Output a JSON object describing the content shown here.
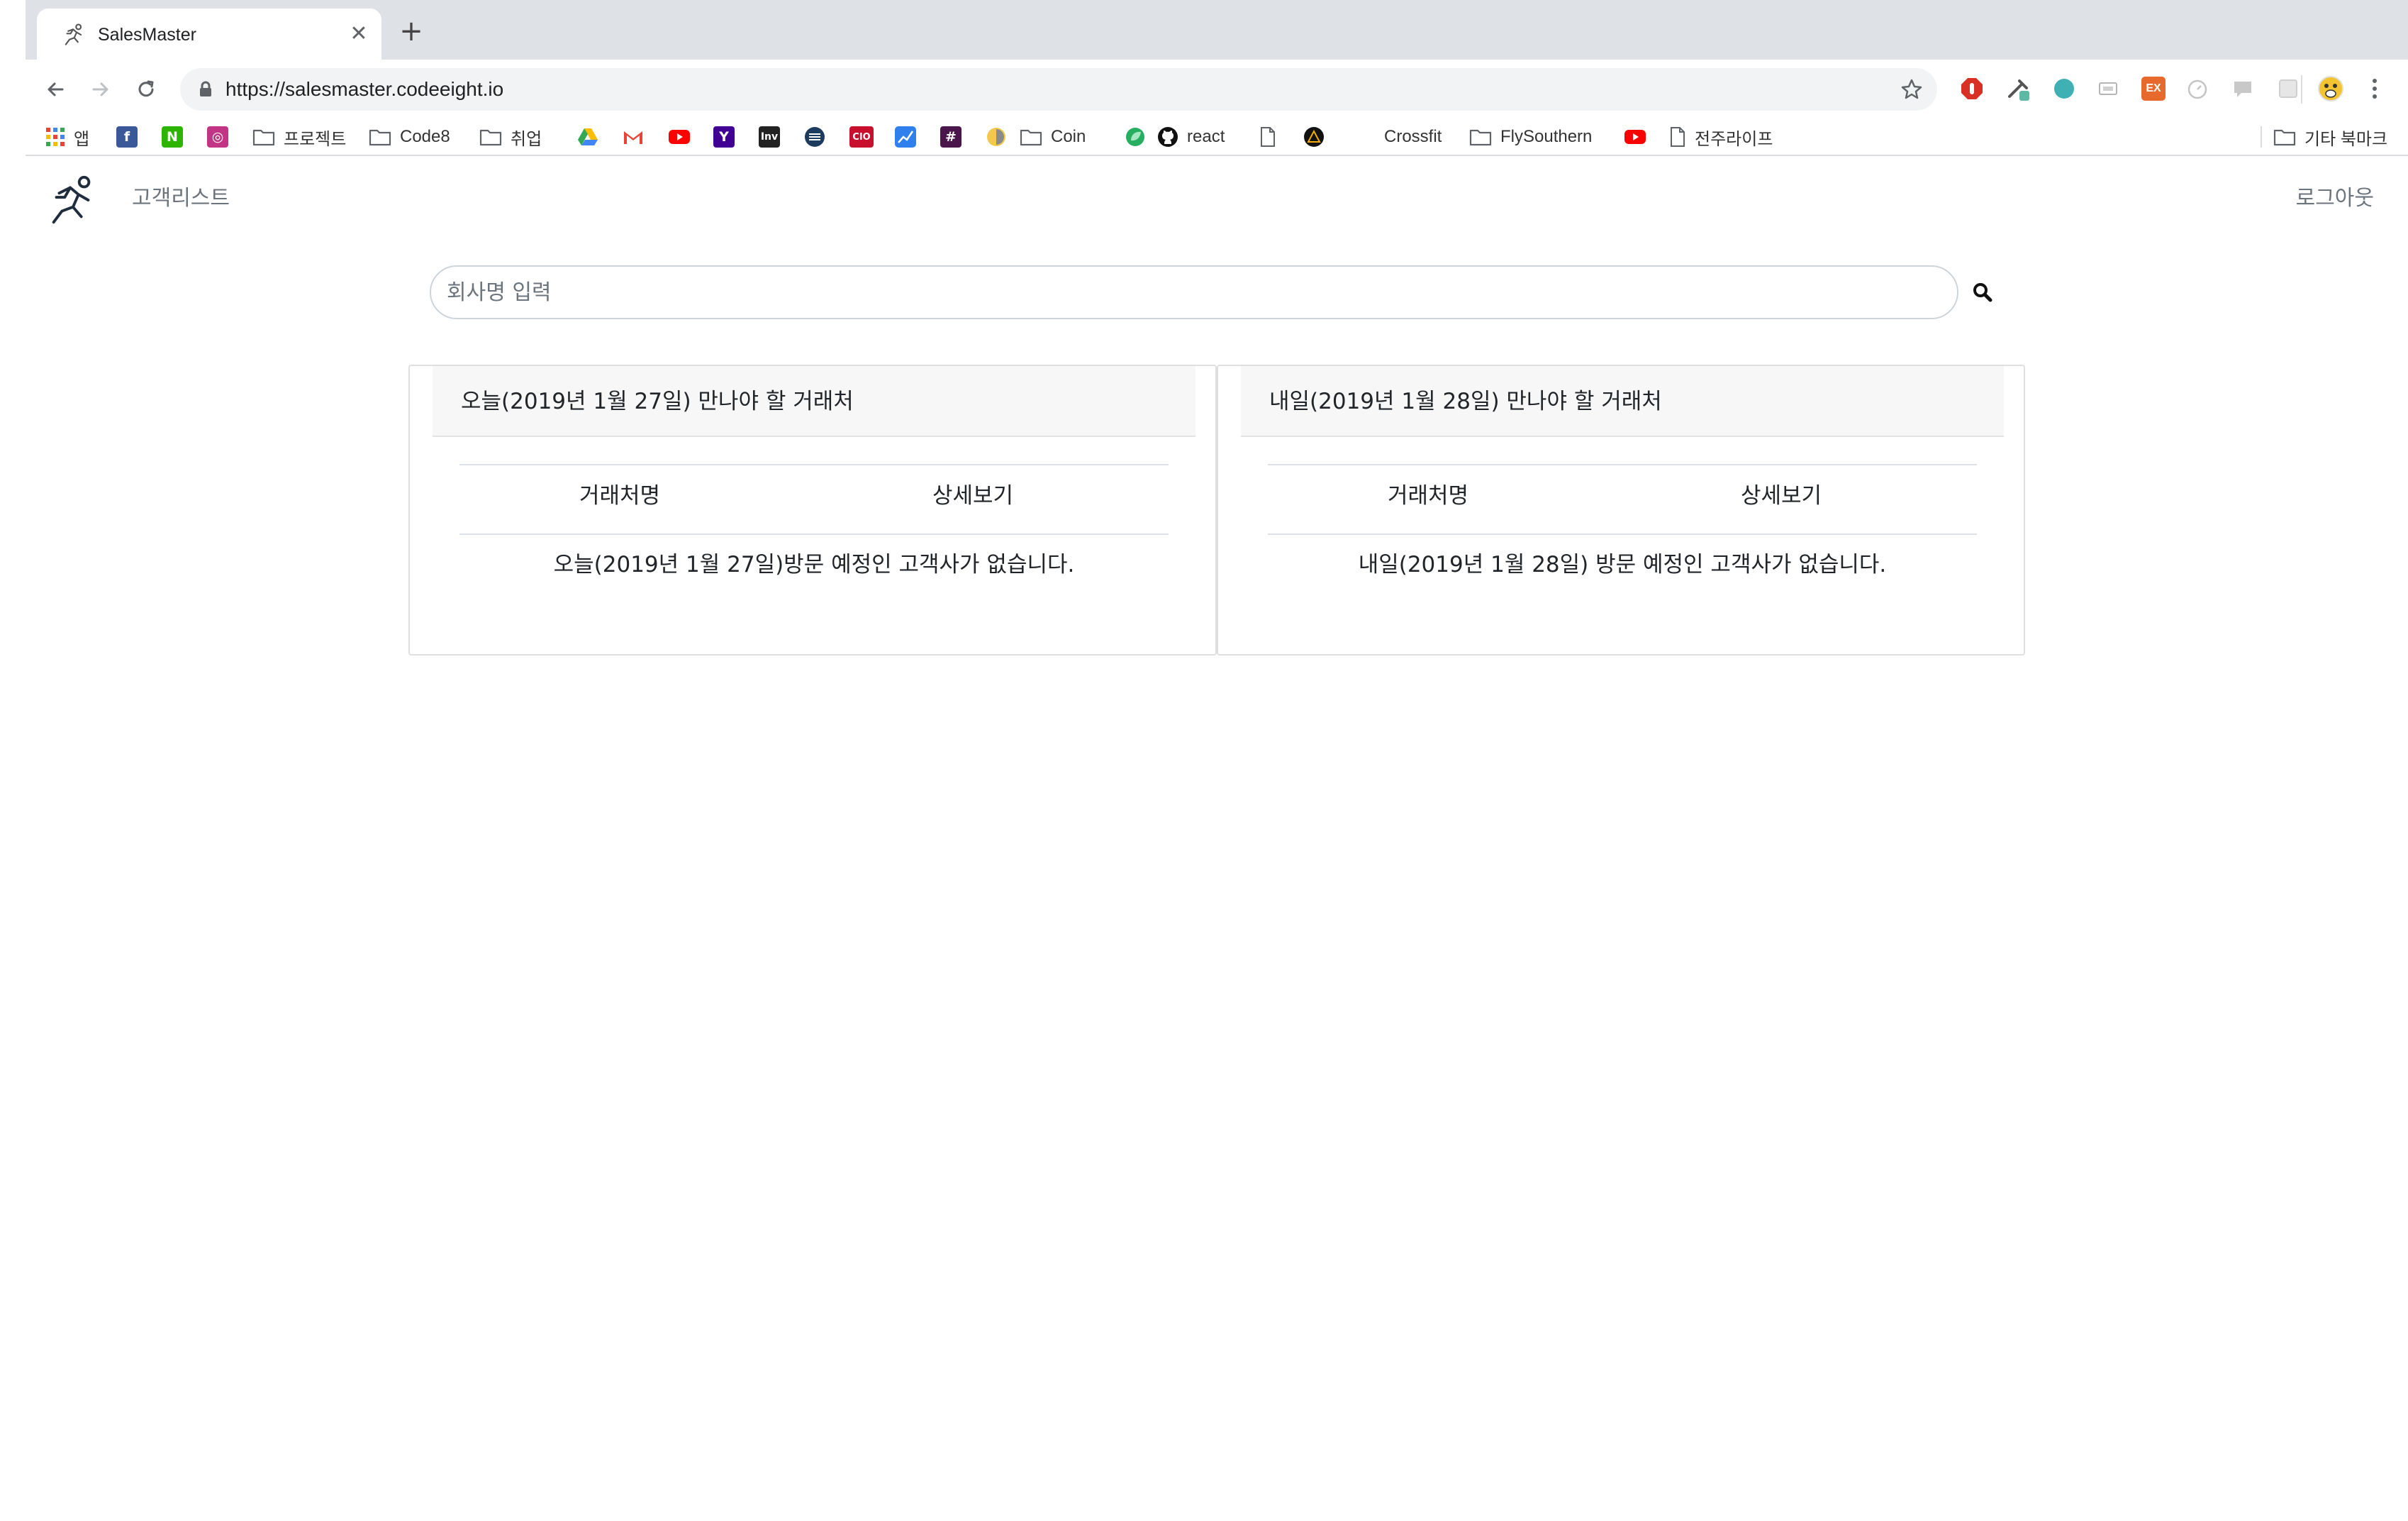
{
  "browser": {
    "tab": {
      "title": "SalesMaster",
      "close_glyph": "✕"
    },
    "new_tab_glyph": "+",
    "url": "https://salesmaster.codeeight.io",
    "bookmarks": [
      {
        "label": "앱",
        "icon": "apps-grid-icon"
      },
      {
        "label": "",
        "icon": "facebook-icon"
      },
      {
        "label": "",
        "icon": "naver-icon"
      },
      {
        "label": "",
        "icon": "instagram-icon"
      },
      {
        "label": "프로젝트",
        "icon": "folder-icon"
      },
      {
        "label": "Code8",
        "icon": "folder-icon"
      },
      {
        "label": "취업",
        "icon": "folder-icon"
      },
      {
        "label": "",
        "icon": "google-drive-icon"
      },
      {
        "label": "",
        "icon": "gmail-icon"
      },
      {
        "label": "",
        "icon": "youtube-icon"
      },
      {
        "label": "",
        "icon": "yahoo-icon"
      },
      {
        "label": "",
        "icon": "investing-icon"
      },
      {
        "label": "",
        "icon": "stack-icon"
      },
      {
        "label": "",
        "icon": "cio-icon"
      },
      {
        "label": "",
        "icon": "chart-icon"
      },
      {
        "label": "",
        "icon": "hashtag-icon"
      },
      {
        "label": "",
        "icon": "coin-logo-icon"
      },
      {
        "label": "Coin",
        "icon": "folder-icon"
      },
      {
        "label": "",
        "icon": "leaf-icon"
      },
      {
        "label": "react",
        "icon": "github-icon"
      },
      {
        "label": "",
        "icon": "page-icon"
      },
      {
        "label": "",
        "icon": "warning-circle-icon"
      },
      {
        "label": "Crossfit",
        "icon": "none"
      },
      {
        "label": "FlySouthern",
        "icon": "folder-icon"
      },
      {
        "label": "",
        "icon": "youtube-icon"
      },
      {
        "label": "전주라이프",
        "icon": "page-icon"
      }
    ],
    "other_bookmarks": "기타 북마크",
    "extension_badges": {
      "ex": "EX"
    }
  },
  "app": {
    "nav": {
      "customer_list": "고객리스트",
      "logout": "로그아웃"
    },
    "search": {
      "placeholder": "회사명 입력"
    },
    "cards": {
      "today": {
        "title": "오늘(2019년 1월 27일) 만나야 할 거래처",
        "col_name": "거래처명",
        "col_detail": "상세보기",
        "empty": "오늘(2019년 1월 27일)방문 예정인 고객사가 없습니다."
      },
      "tomorrow": {
        "title": "내일(2019년 1월 28일) 만나야 할 거래처",
        "col_name": "거래처명",
        "col_detail": "상세보기",
        "empty": "내일(2019년 1월 28일) 방문 예정인 고객사가 없습니다."
      }
    }
  }
}
